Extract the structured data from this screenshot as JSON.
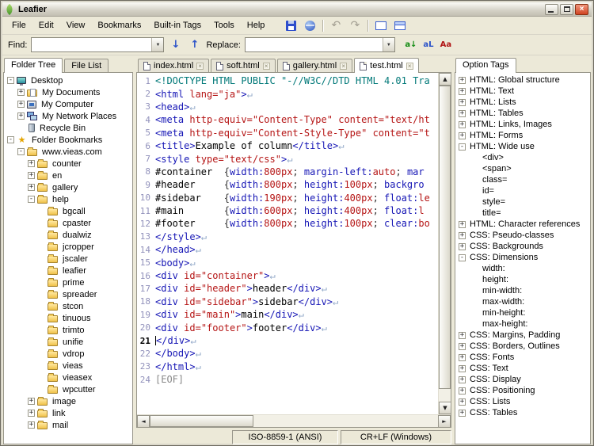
{
  "window": {
    "title": "Leafier"
  },
  "glyphs": {
    "close": "×",
    "dropdown": "▼",
    "scroll_up": "▲",
    "scroll_down": "▼",
    "scroll_left": "◄",
    "scroll_right": "►"
  },
  "colors": {
    "window_bg": "#ece9d8",
    "tag_blue": "#1515b5",
    "attr_red": "#b51515",
    "doctype_teal": "#007878",
    "line_number": "#9191bb",
    "close_red": "#d04321"
  },
  "menubar": {
    "items": [
      "File",
      "Edit",
      "View",
      "Bookmarks",
      "Built-in Tags",
      "Tools",
      "Help"
    ]
  },
  "toolbar": {
    "buttons": [
      {
        "name": "save-icon"
      },
      {
        "name": "preview-icon"
      },
      {
        "name": "sep"
      },
      {
        "name": "undo-icon",
        "glyph": "↶"
      },
      {
        "name": "redo-icon",
        "glyph": "↷"
      },
      {
        "name": "sep"
      },
      {
        "name": "layout-normal-icon"
      },
      {
        "name": "layout-split-icon"
      }
    ]
  },
  "findbar": {
    "find_label": "Find:",
    "find_value": "",
    "replace_label": "Replace:",
    "replace_value": "",
    "next_glyph": "↓",
    "prev_glyph": "↑",
    "option_icons": [
      {
        "name": "replace-next-icon",
        "glyph": "a↓"
      },
      {
        "name": "replace-all-icon",
        "glyph": "aL"
      },
      {
        "name": "match-case-icon",
        "glyph": "Aa"
      }
    ]
  },
  "left_panel": {
    "tabs": [
      {
        "label": "Folder Tree",
        "active": true
      },
      {
        "label": "File List",
        "active": false
      }
    ],
    "tree": [
      {
        "d": 0,
        "e": "-",
        "i": "desktop",
        "l": "Desktop"
      },
      {
        "d": 1,
        "e": "+",
        "i": "mydocs",
        "l": "My Documents"
      },
      {
        "d": 1,
        "e": "+",
        "i": "mycomputer",
        "l": "My Computer"
      },
      {
        "d": 1,
        "e": "+",
        "i": "network",
        "l": "My Network Places"
      },
      {
        "d": 1,
        "e": "",
        "i": "recycle",
        "l": "Recycle Bin"
      },
      {
        "d": 0,
        "e": "-",
        "i": "star",
        "l": "Folder Bookmarks"
      },
      {
        "d": 1,
        "e": "-",
        "i": "folder",
        "l": "www.vieas.com"
      },
      {
        "d": 2,
        "e": "+",
        "i": "folder",
        "l": "counter"
      },
      {
        "d": 2,
        "e": "+",
        "i": "folder",
        "l": "en"
      },
      {
        "d": 2,
        "e": "+",
        "i": "folder",
        "l": "gallery"
      },
      {
        "d": 2,
        "e": "-",
        "i": "folder",
        "l": "help"
      },
      {
        "d": 3,
        "e": "",
        "i": "folder",
        "l": "bgcall"
      },
      {
        "d": 3,
        "e": "",
        "i": "folder",
        "l": "cpaster"
      },
      {
        "d": 3,
        "e": "",
        "i": "folder",
        "l": "dualwiz"
      },
      {
        "d": 3,
        "e": "",
        "i": "folder",
        "l": "jcropper"
      },
      {
        "d": 3,
        "e": "",
        "i": "folder",
        "l": "jscaler"
      },
      {
        "d": 3,
        "e": "",
        "i": "folder",
        "l": "leafier"
      },
      {
        "d": 3,
        "e": "",
        "i": "folder",
        "l": "prime"
      },
      {
        "d": 3,
        "e": "",
        "i": "folder",
        "l": "spreader"
      },
      {
        "d": 3,
        "e": "",
        "i": "folder",
        "l": "stcon"
      },
      {
        "d": 3,
        "e": "",
        "i": "folder",
        "l": "tinuous"
      },
      {
        "d": 3,
        "e": "",
        "i": "folder",
        "l": "trimto"
      },
      {
        "d": 3,
        "e": "",
        "i": "folder",
        "l": "unifie"
      },
      {
        "d": 3,
        "e": "",
        "i": "folder",
        "l": "vdrop"
      },
      {
        "d": 3,
        "e": "",
        "i": "folder",
        "l": "vieas"
      },
      {
        "d": 3,
        "e": "",
        "i": "folder",
        "l": "vieasex"
      },
      {
        "d": 3,
        "e": "",
        "i": "folder",
        "l": "wpcutter"
      },
      {
        "d": 2,
        "e": "+",
        "i": "folder",
        "l": "image"
      },
      {
        "d": 2,
        "e": "+",
        "i": "folder",
        "l": "link"
      },
      {
        "d": 2,
        "e": "+",
        "i": "folder",
        "l": "mail"
      }
    ]
  },
  "editor": {
    "tabs": [
      {
        "label": "index.html",
        "active": false
      },
      {
        "label": "soft.html",
        "active": false
      },
      {
        "label": "gallery.html",
        "active": false
      },
      {
        "label": "test.html",
        "active": true
      }
    ],
    "current_line": 21,
    "lines": [
      [
        [
          "doc",
          "<!DOCTYPE HTML PUBLIC \"-//W3C//DTD HTML 4.01 Tra"
        ]
      ],
      [
        [
          "tag",
          "<html"
        ],
        [
          "pln",
          " "
        ],
        [
          "red",
          "lang=\"ja\""
        ],
        [
          "tag",
          ">"
        ],
        [
          "eol",
          "↵"
        ]
      ],
      [
        [
          "tag",
          "<head>"
        ],
        [
          "eol",
          "↵"
        ]
      ],
      [
        [
          "tag",
          "<meta"
        ],
        [
          "pln",
          " "
        ],
        [
          "red",
          "http-equiv=\"Content-Type\""
        ],
        [
          "pln",
          " "
        ],
        [
          "red",
          "content=\"text/ht"
        ]
      ],
      [
        [
          "tag",
          "<meta"
        ],
        [
          "pln",
          " "
        ],
        [
          "red",
          "http-equiv=\"Content-Style-Type\""
        ],
        [
          "pln",
          " "
        ],
        [
          "red",
          "content=\"t"
        ]
      ],
      [
        [
          "tag",
          "<title>"
        ],
        [
          "pln",
          "Example of column"
        ],
        [
          "tag",
          "</title>"
        ],
        [
          "eol",
          "↵"
        ]
      ],
      [
        [
          "tag",
          "<style"
        ],
        [
          "pln",
          " "
        ],
        [
          "red",
          "type=\"text/css\""
        ],
        [
          "tag",
          ">"
        ],
        [
          "eol",
          "↵"
        ]
      ],
      [
        [
          "pln",
          "#container  "
        ],
        [
          "pun",
          "{"
        ],
        [
          "prp",
          "width:"
        ],
        [
          "val",
          "800px"
        ],
        [
          "pun",
          "; "
        ],
        [
          "prp",
          "margin-left:"
        ],
        [
          "val",
          "auto"
        ],
        [
          "pun",
          "; "
        ],
        [
          "prp",
          "mar"
        ]
      ],
      [
        [
          "pln",
          "#header     "
        ],
        [
          "pun",
          "{"
        ],
        [
          "prp",
          "width:"
        ],
        [
          "val",
          "800px"
        ],
        [
          "pun",
          "; "
        ],
        [
          "prp",
          "height:"
        ],
        [
          "val",
          "100px"
        ],
        [
          "pun",
          "; "
        ],
        [
          "prp",
          "backgro"
        ]
      ],
      [
        [
          "pln",
          "#sidebar    "
        ],
        [
          "pun",
          "{"
        ],
        [
          "prp",
          "width:"
        ],
        [
          "val",
          "190px"
        ],
        [
          "pun",
          "; "
        ],
        [
          "prp",
          "height:"
        ],
        [
          "val",
          "400px"
        ],
        [
          "pun",
          "; "
        ],
        [
          "prp",
          "float:"
        ],
        [
          "val",
          "le"
        ]
      ],
      [
        [
          "pln",
          "#main       "
        ],
        [
          "pun",
          "{"
        ],
        [
          "prp",
          "width:"
        ],
        [
          "val",
          "600px"
        ],
        [
          "pun",
          "; "
        ],
        [
          "prp",
          "height:"
        ],
        [
          "val",
          "400px"
        ],
        [
          "pun",
          "; "
        ],
        [
          "prp",
          "float:"
        ],
        [
          "val",
          "l"
        ]
      ],
      [
        [
          "pln",
          "#footer     "
        ],
        [
          "pun",
          "{"
        ],
        [
          "prp",
          "width:"
        ],
        [
          "val",
          "800px"
        ],
        [
          "pun",
          "; "
        ],
        [
          "prp",
          "height:"
        ],
        [
          "val",
          "100px"
        ],
        [
          "pun",
          "; "
        ],
        [
          "prp",
          "clear:"
        ],
        [
          "val",
          "bo"
        ]
      ],
      [
        [
          "tag",
          "</style>"
        ],
        [
          "eol",
          "↵"
        ]
      ],
      [
        [
          "tag",
          "</head>"
        ],
        [
          "eol",
          "↵"
        ]
      ],
      [
        [
          "tag",
          "<body>"
        ],
        [
          "eol",
          "↵"
        ]
      ],
      [
        [
          "tag",
          "<div"
        ],
        [
          "pln",
          " "
        ],
        [
          "red",
          "id=\"container\""
        ],
        [
          "tag",
          ">"
        ],
        [
          "eol",
          "↵"
        ]
      ],
      [
        [
          "tag",
          "<div"
        ],
        [
          "pln",
          " "
        ],
        [
          "red",
          "id=\"header\""
        ],
        [
          "tag",
          ">"
        ],
        [
          "pln",
          "header"
        ],
        [
          "tag",
          "</div>"
        ],
        [
          "eol",
          "↵"
        ]
      ],
      [
        [
          "tag",
          "<div"
        ],
        [
          "pln",
          " "
        ],
        [
          "red",
          "id=\"sidebar\""
        ],
        [
          "tag",
          ">"
        ],
        [
          "pln",
          "sidebar"
        ],
        [
          "tag",
          "</div>"
        ],
        [
          "eol",
          "↵"
        ]
      ],
      [
        [
          "tag",
          "<div"
        ],
        [
          "pln",
          " "
        ],
        [
          "red",
          "id=\"main\""
        ],
        [
          "tag",
          ">"
        ],
        [
          "pln",
          "main"
        ],
        [
          "tag",
          "</div>"
        ],
        [
          "eol",
          "↵"
        ]
      ],
      [
        [
          "tag",
          "<div"
        ],
        [
          "pln",
          " "
        ],
        [
          "red",
          "id=\"footer\""
        ],
        [
          "tag",
          ">"
        ],
        [
          "pln",
          "footer"
        ],
        [
          "tag",
          "</div>"
        ],
        [
          "eol",
          "↵"
        ]
      ],
      [
        [
          "caret",
          ""
        ],
        [
          "tag",
          "</div>"
        ],
        [
          "eol",
          "↵"
        ]
      ],
      [
        [
          "tag",
          "</body>"
        ],
        [
          "eol",
          "↵"
        ]
      ],
      [
        [
          "tag",
          "</html>"
        ],
        [
          "eol",
          "↵"
        ]
      ],
      [
        [
          "eof",
          "[EOF]"
        ]
      ]
    ]
  },
  "right_panel": {
    "tab": "Option Tags",
    "tree": [
      {
        "d": 0,
        "e": "+",
        "l": "HTML: Global structure"
      },
      {
        "d": 0,
        "e": "+",
        "l": "HTML: Text"
      },
      {
        "d": 0,
        "e": "+",
        "l": "HTML: Lists"
      },
      {
        "d": 0,
        "e": "+",
        "l": "HTML: Tables"
      },
      {
        "d": 0,
        "e": "+",
        "l": "HTML: Links, Images"
      },
      {
        "d": 0,
        "e": "+",
        "l": "HTML: Forms"
      },
      {
        "d": 0,
        "e": "-",
        "l": "HTML: Wide use"
      },
      {
        "d": 1,
        "e": "",
        "l": "<div>"
      },
      {
        "d": 1,
        "e": "",
        "l": "<span>"
      },
      {
        "d": 1,
        "e": "",
        "l": "class="
      },
      {
        "d": 1,
        "e": "",
        "l": "id="
      },
      {
        "d": 1,
        "e": "",
        "l": "style="
      },
      {
        "d": 1,
        "e": "",
        "l": "title="
      },
      {
        "d": 0,
        "e": "+",
        "l": "HTML: Character references"
      },
      {
        "d": 0,
        "e": "+",
        "l": "CSS: Pseudo-classes"
      },
      {
        "d": 0,
        "e": "+",
        "l": "CSS: Backgrounds"
      },
      {
        "d": 0,
        "e": "-",
        "l": "CSS: Dimensions"
      },
      {
        "d": 1,
        "e": "",
        "l": "width:"
      },
      {
        "d": 1,
        "e": "",
        "l": "height:"
      },
      {
        "d": 1,
        "e": "",
        "l": "min-width:"
      },
      {
        "d": 1,
        "e": "",
        "l": "max-width:"
      },
      {
        "d": 1,
        "e": "",
        "l": "min-height:"
      },
      {
        "d": 1,
        "e": "",
        "l": "max-height:"
      },
      {
        "d": 0,
        "e": "+",
        "l": "CSS: Margins, Padding"
      },
      {
        "d": 0,
        "e": "+",
        "l": "CSS: Borders, Outlines"
      },
      {
        "d": 0,
        "e": "+",
        "l": "CSS: Fonts"
      },
      {
        "d": 0,
        "e": "+",
        "l": "CSS: Text"
      },
      {
        "d": 0,
        "e": "+",
        "l": "CSS: Display"
      },
      {
        "d": 0,
        "e": "+",
        "l": "CSS: Positioning"
      },
      {
        "d": 0,
        "e": "+",
        "l": "CSS: Lists"
      },
      {
        "d": 0,
        "e": "+",
        "l": "CSS: Tables"
      }
    ]
  },
  "statusbar": {
    "encoding": "ISO-8859-1 (ANSI)",
    "line_ending": "CR+LF (Windows)"
  }
}
